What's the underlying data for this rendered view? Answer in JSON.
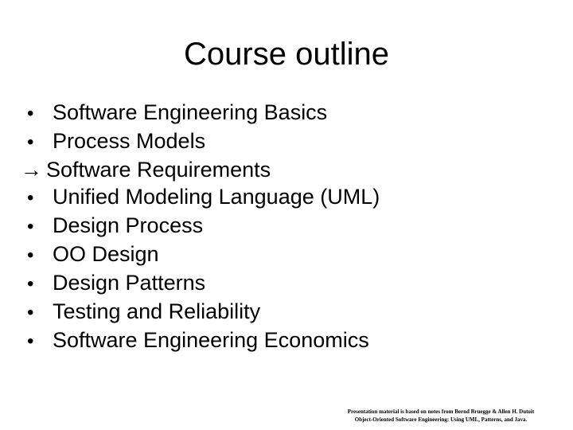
{
  "slide": {
    "title": "Course outline",
    "outline_items": [
      {
        "marker": "•",
        "marker_type": "bullet",
        "label": "Software Engineering Basics"
      },
      {
        "marker": "•",
        "marker_type": "bullet",
        "label": "Process Models"
      },
      {
        "marker": "→",
        "marker_type": "arrow",
        "label": "Software Requirements"
      },
      {
        "marker": "•",
        "marker_type": "bullet",
        "label": "Unified Modeling Language (UML)"
      },
      {
        "marker": "•",
        "marker_type": "bullet",
        "label": "Design Process"
      },
      {
        "marker": "•",
        "marker_type": "bullet",
        "label": "OO Design"
      },
      {
        "marker": "•",
        "marker_type": "bullet",
        "label": "Design Patterns"
      },
      {
        "marker": "•",
        "marker_type": "bullet",
        "label": "Testing and Reliability"
      },
      {
        "marker": "•",
        "marker_type": "bullet",
        "label": "Software Engineering Economics"
      }
    ],
    "footer": {
      "line1": "Presentation material is based on notes from Bernd Bruegge & Allen H. Dutoit",
      "line2": "Object-Oriented Software Engineering: Using UML, Patterns, and Java."
    },
    "colors": {
      "background": "#ffffff",
      "text": "#000000"
    }
  }
}
